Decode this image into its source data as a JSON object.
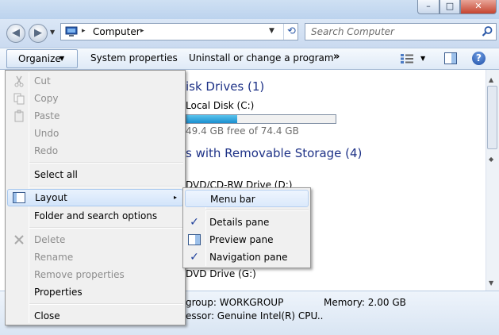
{
  "titlebar": {
    "min": "–",
    "max": "□",
    "close": "✕"
  },
  "address": {
    "crumb": "Computer",
    "sep": "▸",
    "dropdown": "▼",
    "recent": "▼",
    "back": "◀",
    "forward": "▶",
    "refresh": "⟲"
  },
  "search": {
    "placeholder": "Search Computer"
  },
  "cmdbar": {
    "organize": "Organize",
    "organize_arrow": "▼",
    "system_properties": "System properties",
    "uninstall": "Uninstall or change a program",
    "more": "»",
    "views_arrow": "▼",
    "help": "?"
  },
  "content": {
    "hdd_header": "isk Drives (1)",
    "local_disk": "Local Disk (C:)",
    "local_disk_used_fraction": 0.34,
    "free_space": "49.4 GB free of 74.4 GB",
    "removable_header": "s with Removable Storage (4)",
    "dvd_rw": "DVD/CD-RW Drive (D:)",
    "dvd_g": "DVD Drive (G:)"
  },
  "details": {
    "workgroup": "group: WORKGROUP",
    "memory": "Memory: 2.00 GB",
    "processor": "essor: Genuine Intel(R) CPU",
    "ellipsis": "..."
  },
  "organize_menu": {
    "cut": "Cut",
    "copy": "Copy",
    "paste": "Paste",
    "undo": "Undo",
    "redo": "Redo",
    "select_all": "Select all",
    "layout": "Layout",
    "layout_arrow": "▸",
    "folder_options": "Folder and search options",
    "delete": "Delete",
    "rename": "Rename",
    "remove_properties": "Remove properties",
    "properties": "Properties",
    "close": "Close"
  },
  "layout_submenu": {
    "menu_bar": "Menu bar",
    "details_pane": "Details pane",
    "preview_pane": "Preview pane",
    "navigation_pane": "Navigation pane",
    "check": "✓"
  }
}
